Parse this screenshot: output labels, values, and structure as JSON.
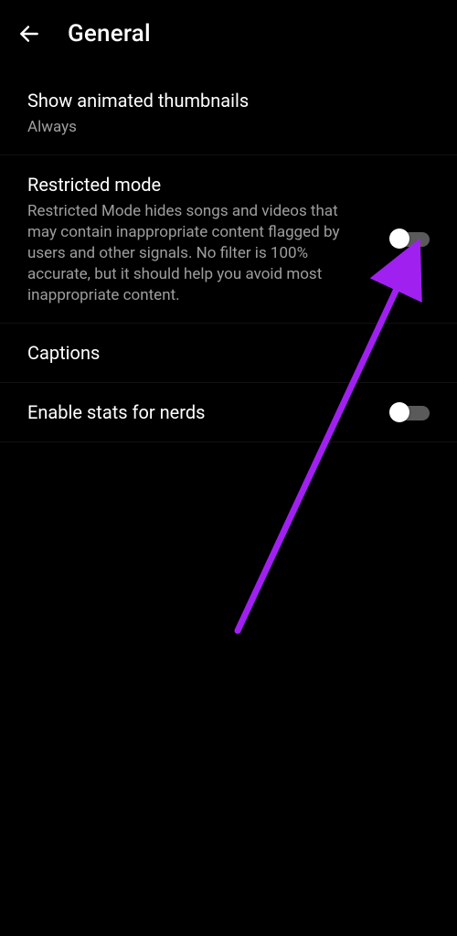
{
  "header": {
    "title": "General"
  },
  "settings": {
    "thumbnails": {
      "title": "Show animated thumbnails",
      "value": "Always"
    },
    "restricted": {
      "title": "Restricted mode",
      "description": "Restricted Mode hides songs and videos that may contain inappropriate content flagged by users and other signals. No filter is 100% accurate, but it should help you avoid most inappropriate content.",
      "enabled": false
    },
    "captions": {
      "title": "Captions"
    },
    "stats": {
      "title": "Enable stats for nerds",
      "enabled": false
    }
  },
  "annotation": {
    "arrow_color": "#a020f0"
  }
}
